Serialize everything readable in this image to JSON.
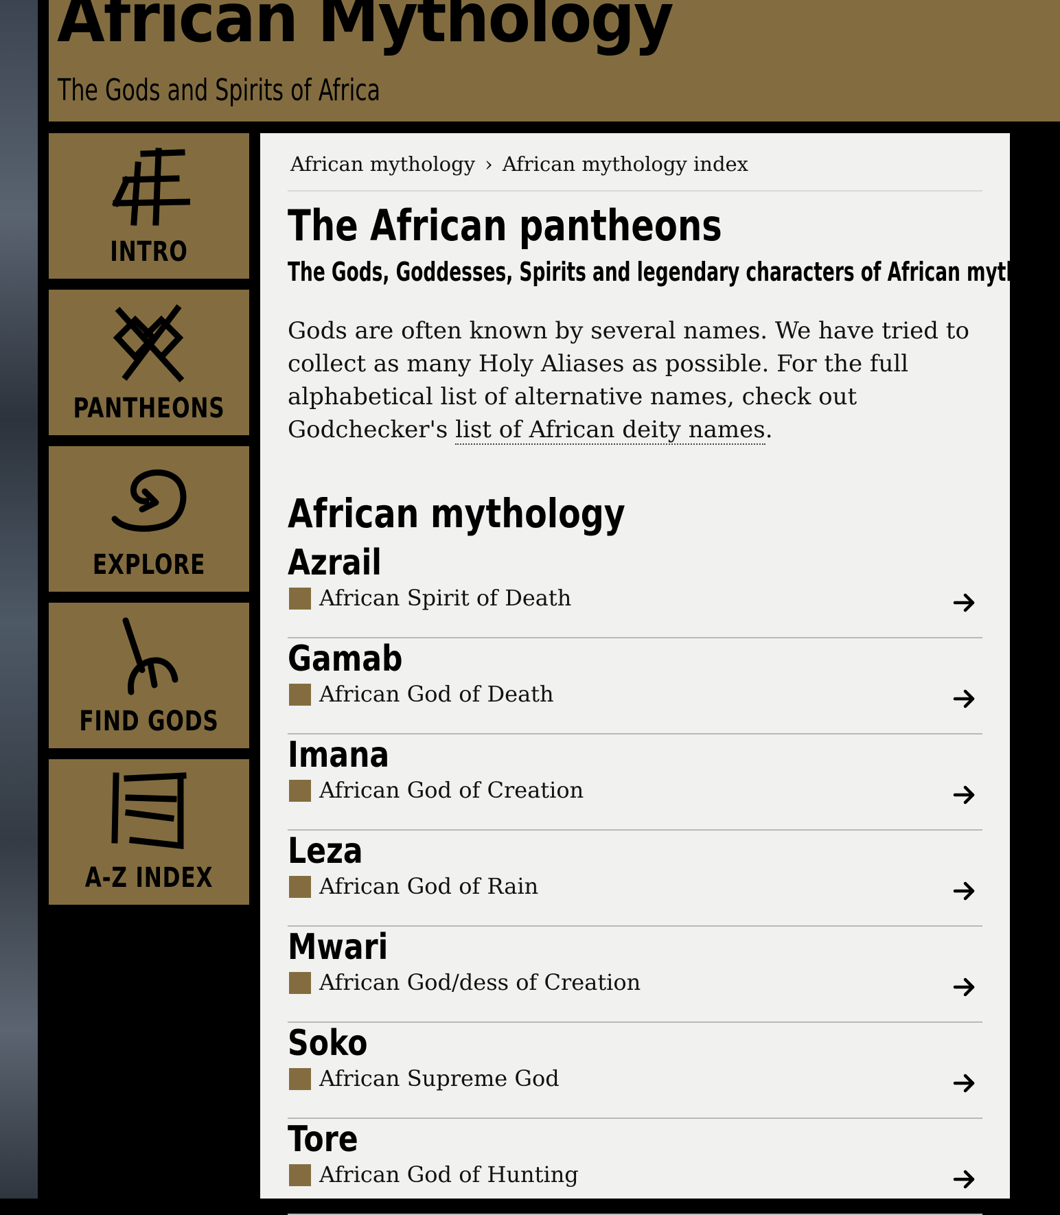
{
  "header": {
    "title": "African Mythology",
    "subtitle": "The Gods and Spirits of Africa"
  },
  "nav": {
    "items": [
      {
        "label": "INTRO",
        "icon": "grid-glyph-icon"
      },
      {
        "label": "PANTHEONS",
        "icon": "crossed-glyph-icon"
      },
      {
        "label": "EXPLORE",
        "icon": "spiral-arrow-icon"
      },
      {
        "label": "FIND GODS",
        "icon": "divining-rod-icon"
      },
      {
        "label": "A-Z INDEX",
        "icon": "lined-book-icon"
      }
    ]
  },
  "breadcrumb": {
    "home": "African mythology",
    "separator": "›",
    "current": "African mythology index"
  },
  "page": {
    "title": "The African pantheons",
    "subtitle": "The Gods, Goddesses, Spirits and legendary characters of African mythology.",
    "intro_text": "Gods are often known by several names. We have tried to collect as many Holy Aliases as possible. For the full alphabetical list of alternative names, check out Godchecker's ",
    "intro_link": "list of African deity names",
    "intro_end": "."
  },
  "section": {
    "title": "African mythology"
  },
  "gods": [
    {
      "name": "Azrail",
      "desc": "African Spirit of Death"
    },
    {
      "name": "Gamab",
      "desc": "African God of Death"
    },
    {
      "name": "Imana",
      "desc": "African God of Creation"
    },
    {
      "name": "Leza",
      "desc": "African God of Rain"
    },
    {
      "name": "Mwari",
      "desc": "African God/dess of Creation"
    },
    {
      "name": "Soko",
      "desc": "African Supreme God"
    },
    {
      "name": "Tore",
      "desc": "African God of Hunting"
    }
  ],
  "colors": {
    "brand": "#836d40",
    "panel": "#f1f1ef",
    "background": "#000000"
  }
}
